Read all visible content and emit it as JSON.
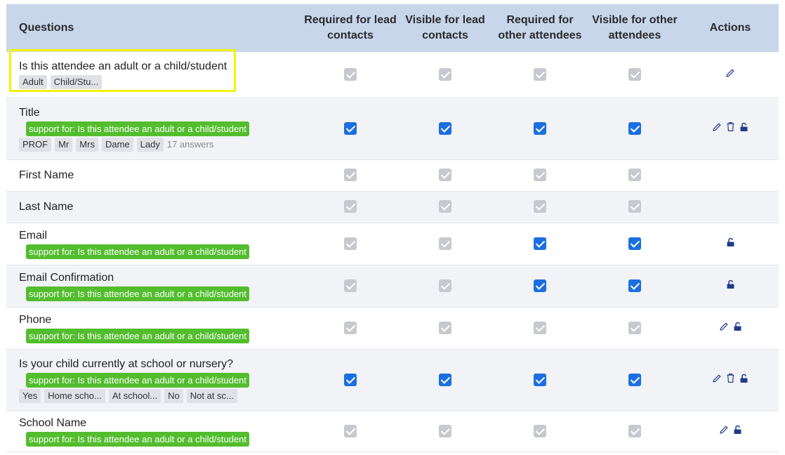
{
  "header": {
    "questions": "Questions",
    "col1": "Required for lead contacts",
    "col2": "Visible for lead contacts",
    "col3": "Required for other attendees",
    "col4": "Visible for other attendees",
    "actions": "Actions"
  },
  "rows": [
    {
      "label": "Is this attendee an adult or a child/student",
      "support": "",
      "tags": [
        "Adult",
        "Child/Stu..."
      ],
      "extra": "",
      "checks": [
        false,
        false,
        false,
        false
      ],
      "actions": [
        "edit"
      ]
    },
    {
      "label": "Title",
      "support": "support for: Is this attendee an adult or a child/student",
      "tags": [
        "PROF",
        "Mr",
        "Mrs",
        "Dame",
        "Lady"
      ],
      "extra": "17 answers",
      "checks": [
        true,
        true,
        true,
        true
      ],
      "actions": [
        "edit",
        "delete",
        "unlock"
      ]
    },
    {
      "label": "First Name",
      "support": "",
      "tags": [],
      "extra": "",
      "checks": [
        false,
        false,
        false,
        false
      ],
      "actions": []
    },
    {
      "label": "Last Name",
      "support": "",
      "tags": [],
      "extra": "",
      "checks": [
        false,
        false,
        false,
        false
      ],
      "actions": []
    },
    {
      "label": "Email",
      "support": "support for: Is this attendee an adult or a child/student",
      "tags": [],
      "extra": "",
      "checks": [
        false,
        false,
        true,
        true
      ],
      "actions": [
        "unlock"
      ]
    },
    {
      "label": "Email Confirmation",
      "support": "support for: Is this attendee an adult or a child/student",
      "tags": [],
      "extra": "",
      "checks": [
        false,
        false,
        true,
        true
      ],
      "actions": [
        "unlock"
      ]
    },
    {
      "label": "Phone",
      "support": "support for: Is this attendee an adult or a child/student",
      "tags": [],
      "extra": "",
      "checks": [
        false,
        false,
        false,
        false
      ],
      "actions": [
        "edit",
        "unlock"
      ]
    },
    {
      "label": "Is your child currently at school or nursery?",
      "support": "support for: Is this attendee an adult or a child/student",
      "tags": [
        "Yes",
        "Home scho...",
        "At school...",
        "No",
        "Not at sc..."
      ],
      "extra": "",
      "checks": [
        true,
        true,
        true,
        true
      ],
      "actions": [
        "edit",
        "delete",
        "unlock"
      ]
    },
    {
      "label": "School Name",
      "support": "support for: Is this attendee an adult or a child/student",
      "tags": [],
      "extra": "",
      "checks": [
        false,
        false,
        false,
        false
      ],
      "actions": [
        "edit",
        "unlock"
      ]
    }
  ],
  "colors": {
    "header_bg": "#c8d6ec",
    "checked": "#1b6fe0",
    "unchecked": "#c7c9cf",
    "support_bg": "#52bd2d",
    "icon": "#1f3c8c",
    "highlight": "#f3f20a"
  }
}
